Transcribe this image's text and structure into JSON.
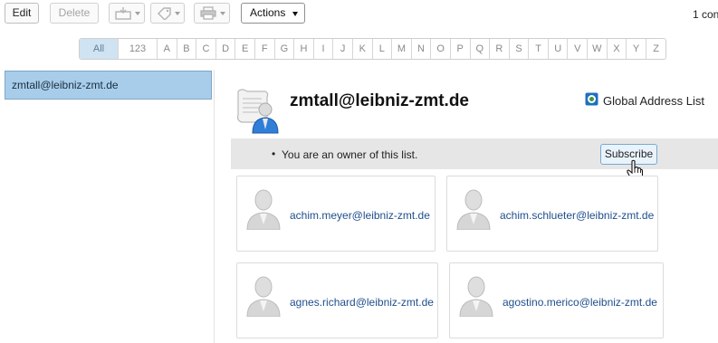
{
  "toolbar": {
    "edit_label": "Edit",
    "delete_label": "Delete",
    "actions_label": "Actions",
    "record_count": "1 con"
  },
  "alphabet": [
    "All",
    "123",
    "A",
    "B",
    "C",
    "D",
    "E",
    "F",
    "G",
    "H",
    "I",
    "J",
    "K",
    "L",
    "M",
    "N",
    "O",
    "P",
    "Q",
    "R",
    "S",
    "T",
    "U",
    "V",
    "W",
    "X",
    "Y",
    "Z"
  ],
  "list": {
    "selected_item": "zmtall@leibniz-zmt.de"
  },
  "details": {
    "title": "zmtall@leibniz-zmt.de",
    "address_book": "Global Address List",
    "owner_message": "You are an owner of this list.",
    "subscribe_label": "Subscribe"
  },
  "members": [
    "achim.meyer@leibniz-zmt.de",
    "achim.schlueter@leibniz-zmt.de",
    "agnes.richard@leibniz-zmt.de",
    "agostino.merico@leibniz-zmt.de"
  ],
  "colors": {
    "selection": "#a7cdea",
    "link": "#1f4e8c",
    "owner_bar": "#e6e6e6"
  }
}
